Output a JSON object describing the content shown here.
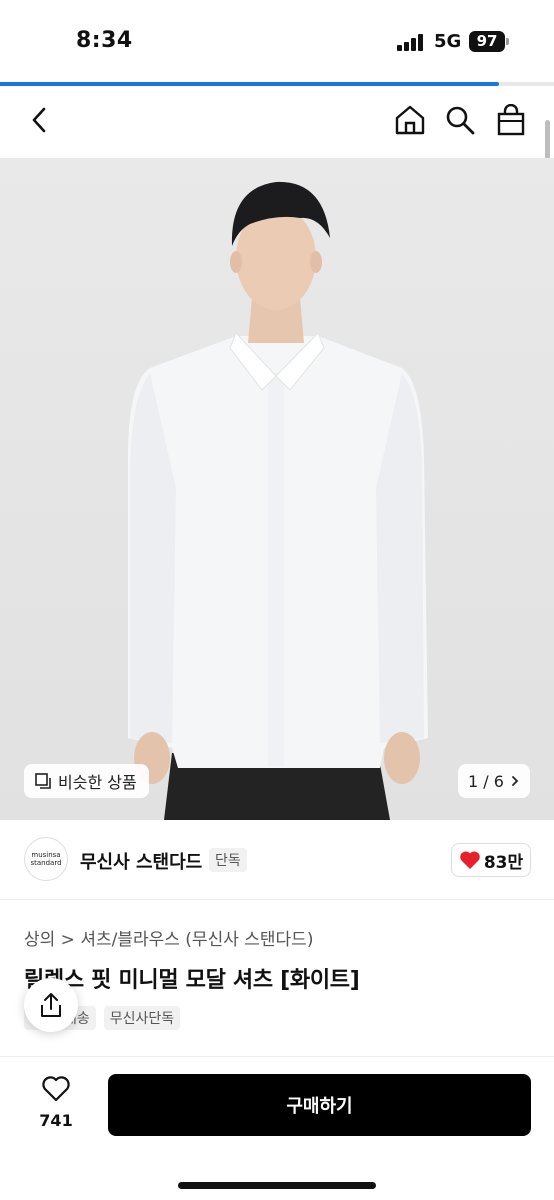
{
  "status": {
    "time": "8:34",
    "network": "5G",
    "battery": "97"
  },
  "page_progress": 0.9,
  "nav": {
    "back_icon": "chevron-left-icon",
    "home_icon": "home-icon",
    "search_icon": "search-icon",
    "bag_icon": "shopping-bag-icon"
  },
  "hero": {
    "similar_label": "비슷한 상품",
    "counter": "1 / 6"
  },
  "brand": {
    "logo_line1": "musinsa",
    "logo_line2": "standard",
    "name": "무신사 스탠다드",
    "exclusive_tag": "단독",
    "likes": "83만"
  },
  "product": {
    "breadcrumb": "상의 > 셔츠/블라우스 (무신사 스탠다드)",
    "title": "릴렉스 핏 미니멀 모달 셔츠 [화이트]",
    "tags": [
      "배송",
      "무신사단독"
    ]
  },
  "bottom": {
    "wish_count": "741",
    "buy_label": "구매하기"
  },
  "colors": {
    "accent": "#1a73e8",
    "like_red": "#e8202a",
    "buy_bg": "#000000"
  }
}
